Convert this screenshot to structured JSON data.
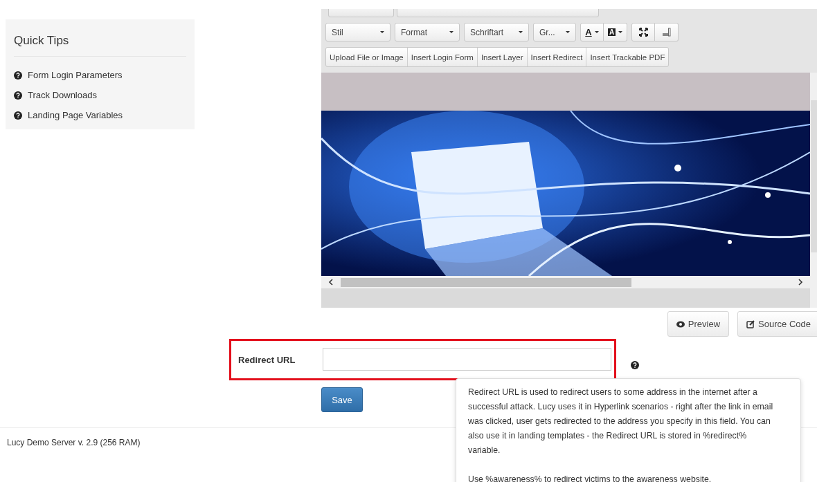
{
  "quick_tips": {
    "title": "Quick Tips",
    "items": [
      "Form Login Parameters",
      "Track Downloads",
      "Landing Page Variables"
    ]
  },
  "editor": {
    "format_bar": [
      {
        "kind": "select",
        "label": "Stil"
      },
      {
        "kind": "select",
        "label": "Format"
      },
      {
        "kind": "select",
        "label": "Schriftart"
      },
      {
        "kind": "select",
        "label": "Gr..."
      },
      {
        "kind": "color",
        "label": "A"
      },
      {
        "kind": "bgcolor",
        "label": "A"
      },
      {
        "kind": "maximize"
      },
      {
        "kind": "blocks"
      }
    ],
    "insert_buttons": [
      "Upload File or Image",
      "Insert Login Form",
      "Insert Layer",
      "Insert Redirect",
      "Insert Trackable PDF"
    ],
    "actions": [
      {
        "kind": "eye",
        "label": "Preview"
      },
      {
        "kind": "edit",
        "label": "Source Code"
      }
    ]
  },
  "redirect": {
    "label": "Redirect URL",
    "highlighted": true,
    "help": [
      "Redirect URL is used to redirect users to some address in the internet after a successful attack. Lucy uses it in Hyperlink scenarios - right after the link in email was clicked, user gets redirected to the address you specify in this field. You can also use it in landing templates - the Redirect URL is stored in %redirect% variable.",
      "Use %awareness% to redirect victims to the awareness website."
    ]
  },
  "save_button": "Save",
  "footer": "Lucy Demo Server v. 2.9 (256 RAM)"
}
